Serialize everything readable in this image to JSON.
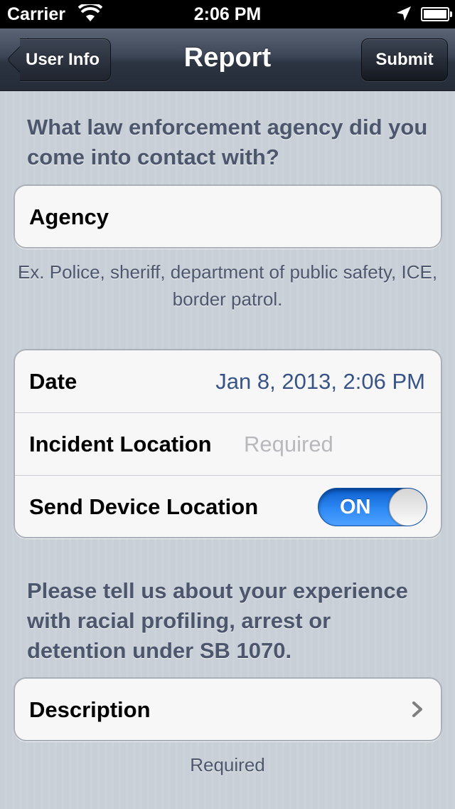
{
  "status_bar": {
    "carrier": "Carrier",
    "time": "2:06 PM"
  },
  "nav": {
    "title": "Report",
    "back_label": "User Info",
    "submit_label": "Submit"
  },
  "agency_section": {
    "header": "What law enforcement agency did you come into contact with?",
    "field_label": "Agency",
    "footer": "Ex. Police, sheriff, department of public safety, ICE, border patrol."
  },
  "details_section": {
    "date_label": "Date",
    "date_value": "Jan 8, 2013, 2:06 PM",
    "location_label": "Incident Location",
    "location_placeholder": "Required",
    "device_location_label": "Send Device Location",
    "device_location_switch": "ON",
    "device_location_enabled": true
  },
  "description_section": {
    "header": "Please tell us about your experience with racial profiling, arrest or detention under SB 1070.",
    "field_label": "Description",
    "footer": "Required"
  },
  "colors": {
    "switch_on": "#2f8af5",
    "value_text": "#385487",
    "section_text": "#4c566c"
  }
}
